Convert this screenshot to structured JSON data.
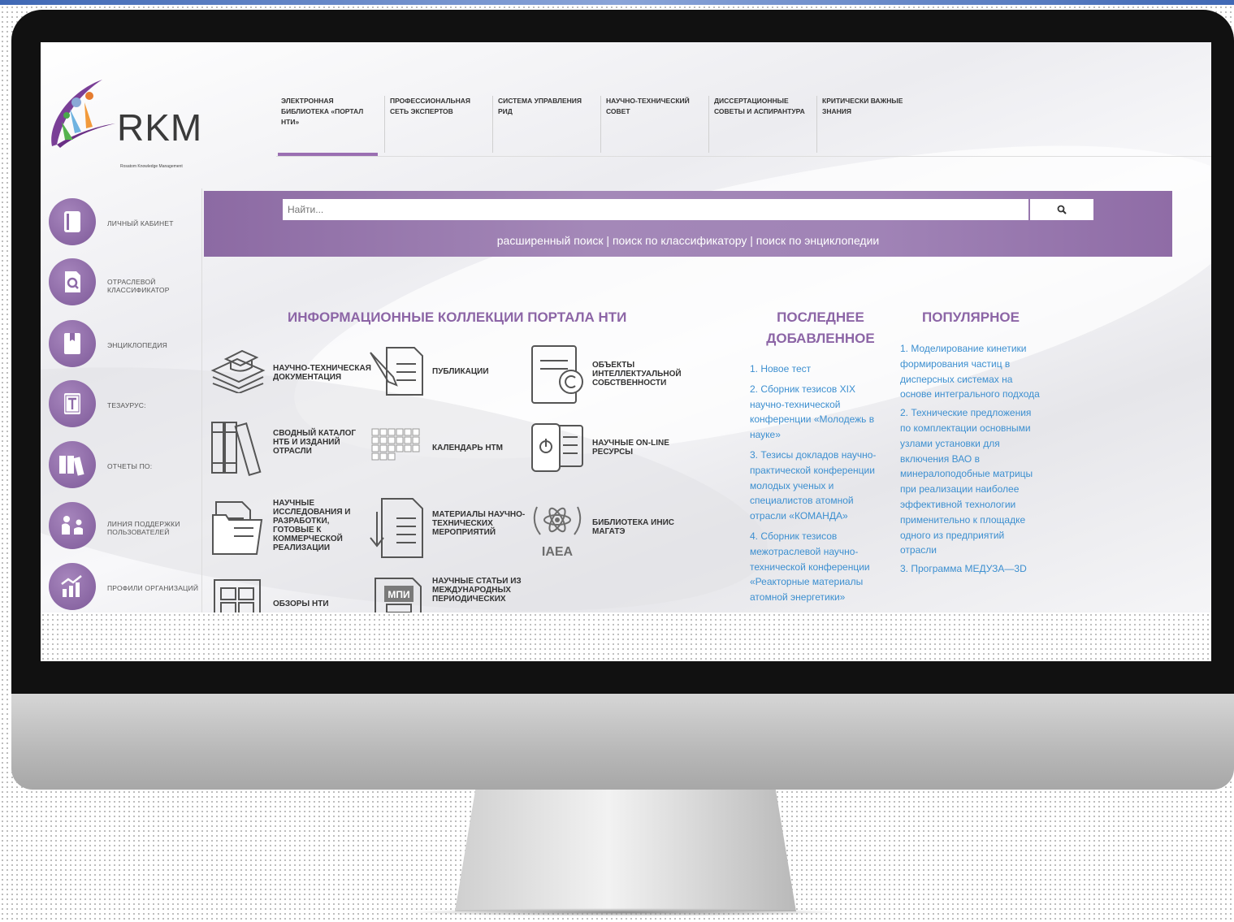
{
  "header": {
    "logo_text": "RKM",
    "logo_subtitle": "Rosatom Knowledge Management",
    "nav": [
      {
        "label": "ЭЛЕКТРОННАЯ БИБЛИОТЕКА «ПОРТАЛ НТИ»",
        "active": true
      },
      {
        "label": "ПРОФЕССИОНАЛЬНАЯ СЕТЬ ЭКСПЕРТОВ"
      },
      {
        "label": "СИСТЕМА УПРАВЛЕНИЯ РИД"
      },
      {
        "label": "НАУЧНО-ТЕХНИЧЕСКИЙ СОВЕТ"
      },
      {
        "label": "ДИССЕРТАЦИОННЫЕ СОВЕТЫ И АСПИРАНТУРА"
      },
      {
        "label": "КРИТИЧЕСКИ ВАЖНЫЕ ЗНАНИЯ"
      }
    ]
  },
  "sidebar": {
    "items": [
      {
        "label": "ЛИЧНЫЙ КАБИНЕТ",
        "icon": "book-icon"
      },
      {
        "label": "ОТРАСЛЕВОЙ КЛАССИФИКАТОР",
        "icon": "file-search-icon"
      },
      {
        "label": "ЭНЦИКЛОПЕДИЯ",
        "icon": "bookmark-book-icon"
      },
      {
        "label": "ТЕЗАУРУС:",
        "icon": "thesaurus-icon"
      },
      {
        "label": "ОТЧЕТЫ ПО:",
        "icon": "binders-icon"
      },
      {
        "label": "ЛИНИЯ ПОДДЕРЖКИ ПОЛЬЗОВАТЕЛЕЙ",
        "icon": "support-icon"
      },
      {
        "label": "ПРОФИЛИ ОРГАНИЗАЦИЙ",
        "icon": "growth-chart-icon"
      }
    ]
  },
  "search": {
    "placeholder": "Найти...",
    "links": [
      "расширенный поиск",
      "поиск по классификатору",
      "поиск по энциклопедии"
    ],
    "separator": " | "
  },
  "collections": {
    "title": "ИНФОРМАЦИОННЫЕ КОЛЛЕКЦИИ ПОРТАЛА НТИ",
    "items": [
      {
        "label": "НАУЧНО-ТЕХНИЧЕСКАЯ ДОКУМЕНТАЦИЯ",
        "icon": "graduation-stack-icon"
      },
      {
        "label": "ПУБЛИКАЦИИ",
        "icon": "document-pencil-icon"
      },
      {
        "label": "ОБЪЕКТЫ ИНТЕЛЛЕКТУАЛЬНОЙ СОБСТВЕННОСТИ",
        "icon": "copyright-document-icon"
      },
      {
        "label": "СВОДНЫЙ КАТАЛОГ НТБ И ИЗДАНИЙ ОТРАСЛИ",
        "icon": "books-icon"
      },
      {
        "label": "КАЛЕНДАРЬ НТМ",
        "icon": "calendar-grid-icon"
      },
      {
        "label": "НАУЧНЫЕ ON-LINE РЕСУРСЫ",
        "icon": "tablet-power-icon"
      },
      {
        "label": "НАУЧНЫЕ ИССЛЕДОВАНИЯ И РАЗРАБОТКИ, ГОТОВЫЕ К КОММЕРЧЕСКОЙ РЕАЛИЗАЦИИ",
        "icon": "folder-documents-icon"
      },
      {
        "label": "МАТЕРИАЛЫ НАУЧНО-ТЕХНИЧЕСКИХ МЕРОПРИЯТИЙ",
        "icon": "document-download-icon"
      },
      {
        "label": "БИБЛИОТЕКА ИНИС МАГАТЭ",
        "icon": "iaea-emblem-icon",
        "emblem_text": "IAEA"
      },
      {
        "label": "ОБЗОРЫ НТИ",
        "icon": "layout-document-icon"
      },
      {
        "label": "НАУЧНЫЕ СТАТЬИ ИЗ МЕЖДУНАРОДНЫХ ПЕРИОДИЧЕСКИХ",
        "icon": "mpi-document-icon",
        "emblem_text": "МПИ"
      }
    ]
  },
  "latest": {
    "title": "ПОСЛЕДНЕЕ ДОБАВЛЕННОЕ",
    "items": [
      "1. Новое тест",
      "2. Сборник тезисов XIX научно-технической конференции «Молодежь в науке»",
      "3. Тезисы докладов научно-практической конференции молодых ученых и специалистов атомной отрасли «КОМАНДА»",
      "4. Сборник тезисов межотраслевой научно-технической конференции «Реакторные материалы атомной энергетики»"
    ]
  },
  "popular": {
    "title": "ПОПУЛЯРНОЕ",
    "items": [
      "1. Моделирование кинетики формирования частиц в дисперсных системах на основе интегрального подхода",
      "2. Технические предложения по комплектации основными узлами установки для включения ВАО в минералоподобные матрицы при реализации наиболее эффективной технологии применительно к площадке одного из предприятий отрасли",
      "3. Программа МЕДУЗА—3D"
    ]
  },
  "colors": {
    "accent": "#8c65a6",
    "link": "#3c8fd0",
    "band": "#9a7db1"
  }
}
